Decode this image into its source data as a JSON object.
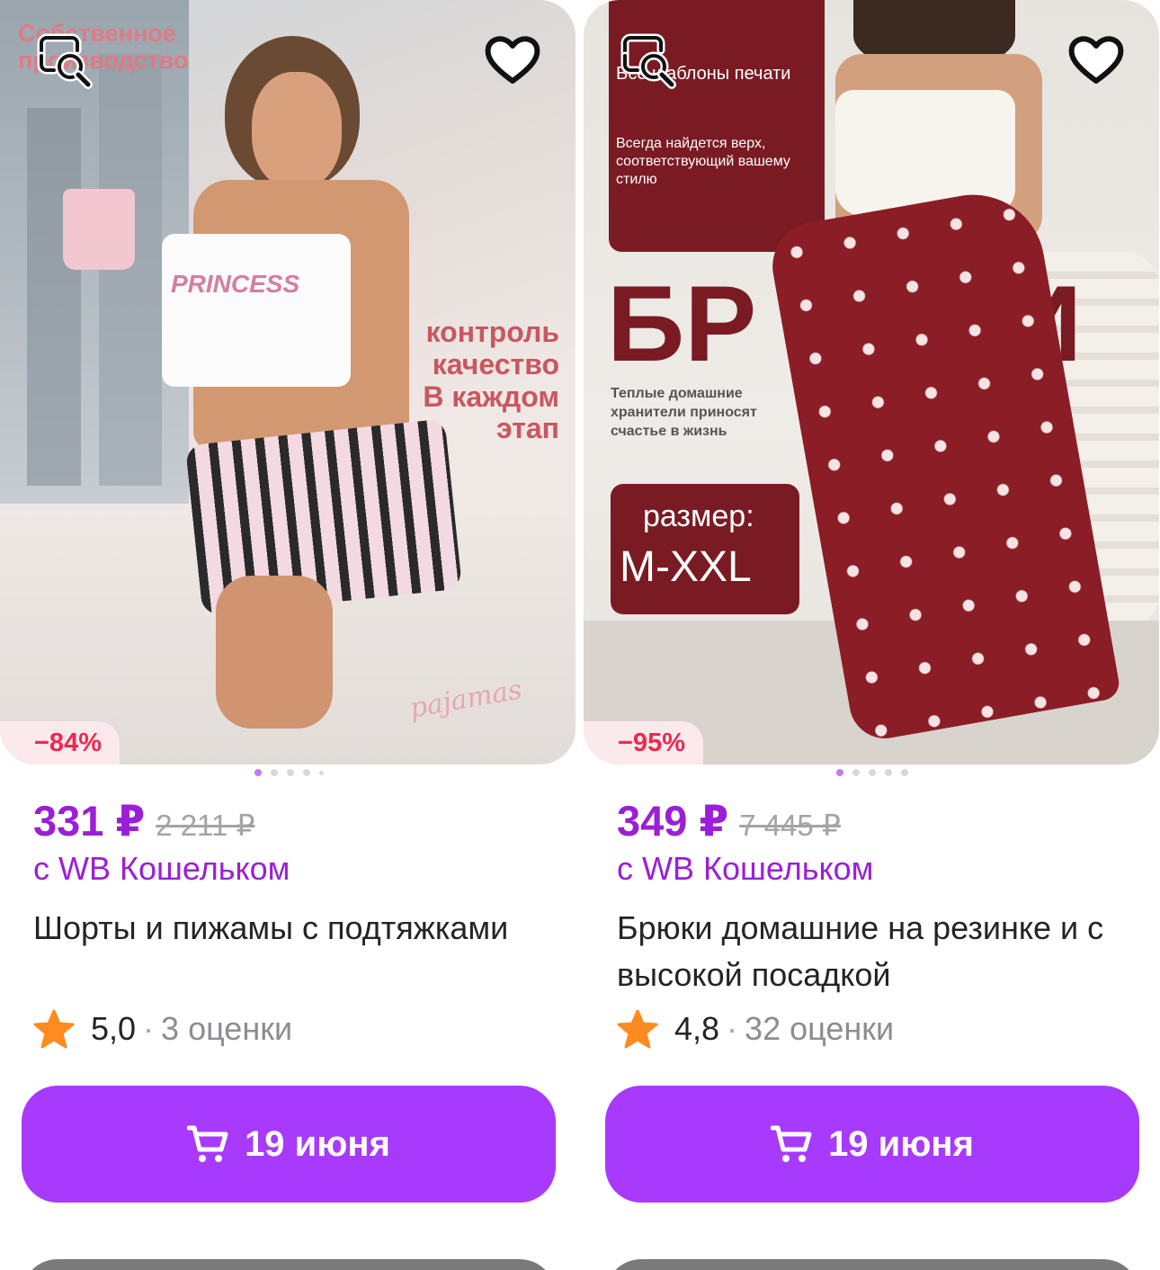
{
  "products": [
    {
      "discount": "−84%",
      "price": "331 ₽",
      "old_price": "2 211 ₽",
      "wallet_note": "с WB Кошельком",
      "title": "Шорты и пижамы с подтяжками",
      "rating": "5,0",
      "separator": "·",
      "reviews": "3 оценки",
      "delivery": "19 июня",
      "photo_texts": {
        "corner": "Собственное производство",
        "side": [
          "контроль",
          "качество",
          "В каждом",
          "этап"
        ],
        "shirt": "PRINCESS",
        "script": "pajamas"
      }
    },
    {
      "discount": "−95%",
      "price": "349 ₽",
      "old_price": "7 445 ₽",
      "wallet_note": "с WB Кошельком",
      "title": "Брюки домашние на резинке и с высокой посадкой",
      "rating": "4,8",
      "separator": "·",
      "reviews": "32 оценки",
      "delivery": "19 июня",
      "photo_texts": {
        "panel_top": "Все шаблоны печати",
        "panel_sub": "Всегда найдется верх, соответствующий вашему стилю",
        "big_word": "БР",
        "big_word_end": "И",
        "warm": "Теплые домашние хранители приносят счастье в жизнь",
        "size_label": "размер:",
        "size_value": "M-XXL"
      }
    }
  ],
  "icons": {
    "search": "image-search-icon",
    "favorite": "heart-icon",
    "cart": "cart-icon",
    "rating": "star-icon"
  },
  "colors": {
    "accent": "#a73afd",
    "price": "#9a1fd8",
    "discount": "#f0284f",
    "star": "#ff8a1f"
  }
}
